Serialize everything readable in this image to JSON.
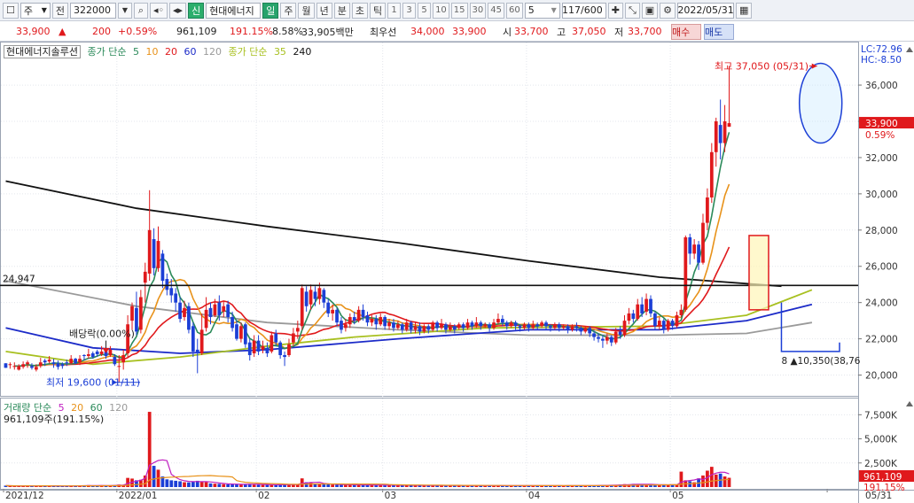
{
  "toolbar": {
    "market": "주",
    "prev": "전",
    "code": "322000",
    "badge": "신",
    "name": "현대에너지",
    "periods": [
      "일",
      "주",
      "월",
      "년",
      "분",
      "초",
      "틱"
    ],
    "minutes": [
      "1",
      "3",
      "5",
      "10",
      "15",
      "30",
      "45",
      "60"
    ],
    "count_sel": "5",
    "page": "117/600",
    "date": "2022/05/31"
  },
  "info": {
    "price": "33,900",
    "arrow": "▲",
    "change": "200",
    "rate": "+0.59%",
    "volume": "961,109",
    "vol_rate": "191.15%",
    "turnover": "8.58%",
    "amount": "33,905백만",
    "best_label": "최우선",
    "ask": "34,000",
    "bid": "33,900",
    "open_label": "시",
    "open": "33,700",
    "high_label": "고",
    "high": "37,050",
    "low_label": "저",
    "low": "33,700",
    "buy": "매수",
    "sell": "매도"
  },
  "legend": {
    "title": "현대에너지솔루션",
    "ma_label": "종가 단순",
    "ma": [
      "5",
      "10",
      "20",
      "60",
      "120"
    ],
    "ma2_label": "종가 단순",
    "ma2": [
      "35",
      "240"
    ],
    "vol_label": "거래량 단순",
    "vol_ma": [
      "5",
      "20",
      "60",
      "120"
    ],
    "vol_value": "961,109주(191.15%)"
  },
  "colors": {
    "up": "#e0191c",
    "down": "#1c3fd6",
    "ma5": "#2b8a5a",
    "ma10": "#e8921a",
    "ma20": "#e0191c",
    "ma60": "#1c2bc8",
    "ma120": "#9a9a9a",
    "ma35": "#a8c020",
    "ma240": "#111111"
  },
  "chart_data": {
    "type": "candlestick",
    "price_axis": {
      "ticks": [
        "36,000",
        "34,000",
        "32,000",
        "30,000",
        "28,000",
        "26,000",
        "24,000",
        "22,000",
        "20,000"
      ],
      "tick_values": [
        36000,
        34000,
        32000,
        30000,
        28000,
        26000,
        24000,
        22000,
        20000
      ],
      "range": [
        19000,
        38300
      ]
    },
    "volume_axis": {
      "ticks": [
        "7,500K",
        "5,000K",
        "2,500K"
      ],
      "tick_values": [
        7500000,
        5000000,
        2500000
      ],
      "range": [
        0,
        9000000
      ]
    },
    "x_labels": [
      "2021/12",
      "2022/01",
      "02",
      "03",
      "04",
      "05",
      "05/31"
    ],
    "x_label_pos": [
      0,
      26,
      58,
      87,
      120,
      153,
      189
    ],
    "n_bars": 190,
    "annotations": {
      "high": "최고 37,050 (05/31)",
      "low": "최저 19,600 (01/11)",
      "dividend": "배당락(0.00%)",
      "line_level_text": "24,947",
      "line_level": 24947,
      "lc": "LC:72.96",
      "hc": "HC:-8.50",
      "last_price": "33,900",
      "last_rate": "0.59%",
      "last_volume": "961,109",
      "last_vol_rate": "191.15%",
      "count_box": "8 ▲10,350(38,76"
    },
    "ma_values": {
      "ma240": [
        [
          0,
          30700
        ],
        [
          30,
          29200
        ],
        [
          60,
          28200
        ],
        [
          90,
          27300
        ],
        [
          120,
          26300
        ],
        [
          150,
          25400
        ],
        [
          178,
          24900
        ]
      ],
      "ma120": [
        [
          0,
          25200
        ],
        [
          30,
          23800
        ],
        [
          60,
          22900
        ],
        [
          90,
          22500
        ],
        [
          120,
          22200
        ],
        [
          150,
          22200
        ],
        [
          170,
          22300
        ],
        [
          185,
          22900
        ]
      ],
      "ma60": [
        [
          0,
          22600
        ],
        [
          20,
          21500
        ],
        [
          40,
          21200
        ],
        [
          60,
          21400
        ],
        [
          90,
          22000
        ],
        [
          120,
          22500
        ],
        [
          150,
          22500
        ],
        [
          170,
          23000
        ],
        [
          185,
          23900
        ]
      ],
      "ma35": [
        [
          0,
          21300
        ],
        [
          20,
          20600
        ],
        [
          40,
          21000
        ],
        [
          60,
          21600
        ],
        [
          80,
          22100
        ],
        [
          110,
          22600
        ],
        [
          150,
          22700
        ],
        [
          170,
          23300
        ],
        [
          185,
          24700
        ]
      ]
    },
    "candles_ohlc": [
      [
        20650,
        20400,
        20400,
        20650
      ],
      [
        20550,
        20600,
        20350,
        20700
      ],
      [
        20450,
        20500,
        20300,
        20700
      ],
      [
        20300,
        20500,
        20250,
        20600
      ],
      [
        20450,
        20600,
        20350,
        20750
      ],
      [
        20600,
        20700,
        20400,
        20800
      ],
      [
        20500,
        20400,
        20300,
        20650
      ],
      [
        20300,
        20450,
        20200,
        20600
      ],
      [
        20500,
        20700,
        20400,
        20950
      ],
      [
        20800,
        20700,
        20500,
        20900
      ],
      [
        20750,
        20850,
        20650,
        21050
      ],
      [
        20700,
        20600,
        20400,
        20900
      ],
      [
        20650,
        20450,
        20300,
        20800
      ],
      [
        20600,
        20500,
        20350,
        20700
      ],
      [
        20700,
        20650,
        20500,
        20850
      ],
      [
        20650,
        20900,
        20600,
        21100
      ],
      [
        20900,
        20650,
        20600,
        20950
      ],
      [
        20700,
        20900,
        20550,
        21100
      ],
      [
        21100,
        21050,
        20800,
        21150
      ],
      [
        21050,
        21150,
        20900,
        21450
      ],
      [
        21200,
        21000,
        20900,
        21300
      ],
      [
        21300,
        21150,
        21000,
        21400
      ],
      [
        21150,
        21300,
        21050,
        21600
      ],
      [
        21300,
        21050,
        20900,
        21400
      ],
      [
        21100,
        21400,
        21000,
        21600
      ],
      [
        21000,
        20600,
        20500,
        21150
      ],
      [
        20500,
        20500,
        19600,
        21100
      ],
      [
        20700,
        21100,
        20300,
        21400
      ],
      [
        21200,
        22800,
        21000,
        23300
      ],
      [
        23000,
        23800,
        22500,
        24000
      ],
      [
        23700,
        22400,
        22200,
        24600
      ],
      [
        22500,
        24300,
        22300,
        24700
      ],
      [
        25100,
        25700,
        24000,
        26200
      ],
      [
        25600,
        28000,
        25200,
        30200
      ],
      [
        27500,
        25900,
        25500,
        28100
      ],
      [
        25900,
        27400,
        25700,
        28200
      ],
      [
        26700,
        25200,
        24800,
        26900
      ],
      [
        25300,
        24700,
        24400,
        25600
      ],
      [
        24800,
        24400,
        24000,
        25300
      ],
      [
        24500,
        24000,
        23500,
        24800
      ],
      [
        24000,
        23100,
        22900,
        24300
      ],
      [
        23200,
        23700,
        23000,
        24100
      ],
      [
        23800,
        22500,
        22300,
        24000
      ],
      [
        22700,
        21300,
        21000,
        22900
      ],
      [
        21400,
        21200,
        20100,
        22000
      ],
      [
        21200,
        22500,
        21100,
        23400
      ],
      [
        22600,
        23600,
        22400,
        24300
      ],
      [
        23700,
        23200,
        22800,
        24000
      ],
      [
        23300,
        23900,
        23200,
        24200
      ],
      [
        24000,
        23300,
        23000,
        24400
      ],
      [
        23500,
        23800,
        23200,
        24100
      ],
      [
        23900,
        23200,
        22900,
        24100
      ],
      [
        23200,
        22600,
        22400,
        23500
      ],
      [
        22800,
        22000,
        21900,
        23000
      ],
      [
        22000,
        22700,
        21800,
        22900
      ],
      [
        22800,
        21700,
        21500,
        22900
      ],
      [
        21800,
        21100,
        20800,
        22000
      ],
      [
        21200,
        21900,
        21000,
        22200
      ],
      [
        21900,
        21300,
        21100,
        22200
      ],
      [
        21400,
        21600,
        21200,
        21900
      ],
      [
        21500,
        21200,
        21000,
        21800
      ],
      [
        21300,
        22200,
        21200,
        22400
      ],
      [
        22300,
        21800,
        21600,
        22500
      ],
      [
        21800,
        21100,
        20900,
        21900
      ],
      [
        21100,
        21000,
        20500,
        21300
      ],
      [
        21100,
        21700,
        21000,
        22000
      ],
      [
        21800,
        22300,
        21600,
        22600
      ],
      [
        22400,
        22600,
        22000,
        23000
      ],
      [
        22700,
        24800,
        22500,
        25000
      ],
      [
        24600,
        23800,
        23500,
        24900
      ],
      [
        23900,
        24700,
        23600,
        25000
      ],
      [
        24600,
        24200,
        23800,
        24900
      ],
      [
        24200,
        24800,
        23900,
        25100
      ],
      [
        24700,
        24000,
        23700,
        24800
      ],
      [
        24000,
        23400,
        23200,
        24200
      ],
      [
        23400,
        23600,
        23000,
        23900
      ],
      [
        23600,
        22900,
        22700,
        23700
      ],
      [
        23000,
        22500,
        22300,
        23200
      ],
      [
        22600,
        22800,
        22400,
        23100
      ],
      [
        22800,
        23200,
        22600,
        23400
      ],
      [
        23200,
        23000,
        22800,
        23500
      ],
      [
        23000,
        23600,
        22900,
        23800
      ],
      [
        23600,
        23200,
        23000,
        23900
      ],
      [
        23300,
        22900,
        22700,
        23500
      ],
      [
        22900,
        23100,
        22700,
        23300
      ],
      [
        23100,
        22800,
        22500,
        23300
      ],
      [
        22800,
        23200,
        22700,
        23400
      ],
      [
        23200,
        22700,
        22500,
        23300
      ],
      [
        22700,
        22900,
        22500,
        23100
      ],
      [
        22900,
        22600,
        22400,
        23100
      ],
      [
        22600,
        22800,
        22500,
        23000
      ],
      [
        22800,
        22500,
        22300,
        22900
      ],
      [
        22500,
        22900,
        22400,
        23100
      ],
      [
        22900,
        22500,
        22300,
        23000
      ],
      [
        22500,
        22700,
        22300,
        22900
      ],
      [
        22700,
        22400,
        22200,
        22900
      ],
      [
        22400,
        22700,
        22300,
        22800
      ],
      [
        22700,
        22500,
        22300,
        22800
      ],
      [
        22500,
        22900,
        22400,
        23000
      ],
      [
        22900,
        22600,
        22400,
        23000
      ],
      [
        22600,
        22800,
        22500,
        23100
      ],
      [
        22800,
        22500,
        22300,
        22900
      ],
      [
        22500,
        22700,
        22400,
        22900
      ],
      [
        22700,
        22500,
        22300,
        22800
      ],
      [
        22600,
        22800,
        22500,
        22900
      ],
      [
        22800,
        22600,
        22400,
        22900
      ],
      [
        22600,
        22900,
        22500,
        23100
      ],
      [
        22900,
        22700,
        22500,
        23000
      ],
      [
        22700,
        22900,
        22600,
        23200
      ],
      [
        22900,
        22700,
        22500,
        23000
      ],
      [
        22700,
        22800,
        22600,
        22900
      ],
      [
        22800,
        22600,
        22400,
        22900
      ],
      [
        22600,
        22900,
        22500,
        23100
      ],
      [
        22900,
        23100,
        22800,
        23400
      ],
      [
        23100,
        22900,
        22700,
        23300
      ],
      [
        22900,
        22700,
        22500,
        23000
      ],
      [
        22700,
        22900,
        22600,
        23000
      ],
      [
        22900,
        22700,
        22500,
        23000
      ],
      [
        22700,
        22600,
        22400,
        22800
      ],
      [
        22600,
        22800,
        22500,
        22900
      ],
      [
        22800,
        22600,
        22400,
        22900
      ],
      [
        22600,
        22800,
        22500,
        23000
      ],
      [
        22800,
        22700,
        22500,
        22900
      ],
      [
        22700,
        22900,
        22600,
        23000
      ],
      [
        22900,
        22700,
        22500,
        23000
      ],
      [
        22700,
        22600,
        22400,
        22800
      ],
      [
        22600,
        22800,
        22500,
        22900
      ],
      [
        22800,
        22600,
        22400,
        22900
      ],
      [
        22600,
        22700,
        22500,
        22800
      ],
      [
        22700,
        22500,
        22300,
        22800
      ],
      [
        22500,
        22700,
        22400,
        22800
      ],
      [
        22700,
        22600,
        22400,
        22900
      ],
      [
        22600,
        22400,
        22200,
        22700
      ],
      [
        22400,
        22600,
        22300,
        22700
      ],
      [
        22600,
        22300,
        22100,
        22700
      ],
      [
        22300,
        22100,
        21900,
        22400
      ],
      [
        22100,
        22000,
        21800,
        22300
      ],
      [
        22000,
        21900,
        21500,
        22200
      ],
      [
        21900,
        22100,
        21700,
        22300
      ],
      [
        22100,
        21800,
        21600,
        22200
      ],
      [
        21800,
        22400,
        21700,
        22600
      ],
      [
        22400,
        22200,
        22000,
        22700
      ],
      [
        22200,
        23000,
        22100,
        23300
      ],
      [
        23000,
        23400,
        22800,
        23700
      ],
      [
        23400,
        23100,
        22900,
        23600
      ],
      [
        23100,
        23900,
        23000,
        24200
      ],
      [
        23900,
        23400,
        23200,
        24300
      ],
      [
        23500,
        24200,
        23300,
        24500
      ],
      [
        24200,
        23400,
        23200,
        24400
      ],
      [
        23400,
        22700,
        22500,
        23500
      ],
      [
        22700,
        23000,
        22500,
        23200
      ],
      [
        23000,
        22500,
        22300,
        23100
      ],
      [
        22500,
        23000,
        22400,
        23100
      ],
      [
        23000,
        22700,
        22500,
        23100
      ],
      [
        22700,
        23300,
        22600,
        23500
      ],
      [
        23300,
        23600,
        23200,
        23900
      ],
      [
        23600,
        27600,
        23500,
        27700
      ],
      [
        27600,
        26700,
        26100,
        27800
      ],
      [
        26700,
        27200,
        26400,
        27500
      ],
      [
        27200,
        26200,
        25800,
        27400
      ],
      [
        26200,
        28400,
        26100,
        28900
      ],
      [
        28400,
        29800,
        28000,
        30300
      ],
      [
        29800,
        32300,
        29500,
        32800
      ],
      [
        32300,
        34000,
        31500,
        34200
      ],
      [
        33800,
        32800,
        31900,
        35200
      ],
      [
        32800,
        34000,
        32300,
        34900
      ],
      [
        33700,
        33900,
        33700,
        37050
      ]
    ],
    "volume_k": [
      150,
      120,
      110,
      100,
      130,
      140,
      110,
      100,
      160,
      130,
      120,
      110,
      100,
      110,
      120,
      150,
      120,
      140,
      180,
      200,
      130,
      150,
      160,
      140,
      170,
      200,
      260,
      240,
      950,
      880,
      700,
      760,
      1200,
      7800,
      2200,
      1800,
      1100,
      800,
      700,
      650,
      600,
      500,
      480,
      600,
      650,
      550,
      500,
      380,
      350,
      330,
      300,
      280,
      290,
      310,
      260,
      300,
      330,
      280,
      250,
      240,
      230,
      250,
      220,
      260,
      280,
      240,
      260,
      270,
      900,
      500,
      420,
      360,
      330,
      300,
      280,
      260,
      250,
      240,
      230,
      250,
      240,
      230,
      220,
      210,
      200,
      210,
      200,
      190,
      200,
      190,
      180,
      190,
      200,
      190,
      180,
      170,
      180,
      170,
      180,
      170,
      170,
      160,
      170,
      160,
      170,
      160,
      150,
      160,
      150,
      160,
      150,
      150,
      160,
      150,
      140,
      150,
      140,
      150,
      140,
      150,
      140,
      150,
      140,
      150,
      140,
      140,
      150,
      140,
      140,
      150,
      140,
      150,
      160,
      150,
      160,
      170,
      180,
      190,
      180,
      200,
      220,
      260,
      300,
      280,
      330,
      300,
      280,
      260,
      240,
      230,
      220,
      230,
      240,
      260,
      260,
      1600,
      700,
      600,
      500,
      900,
      1200,
      1700,
      2100,
      1300,
      1400,
      1100,
      961
    ]
  }
}
